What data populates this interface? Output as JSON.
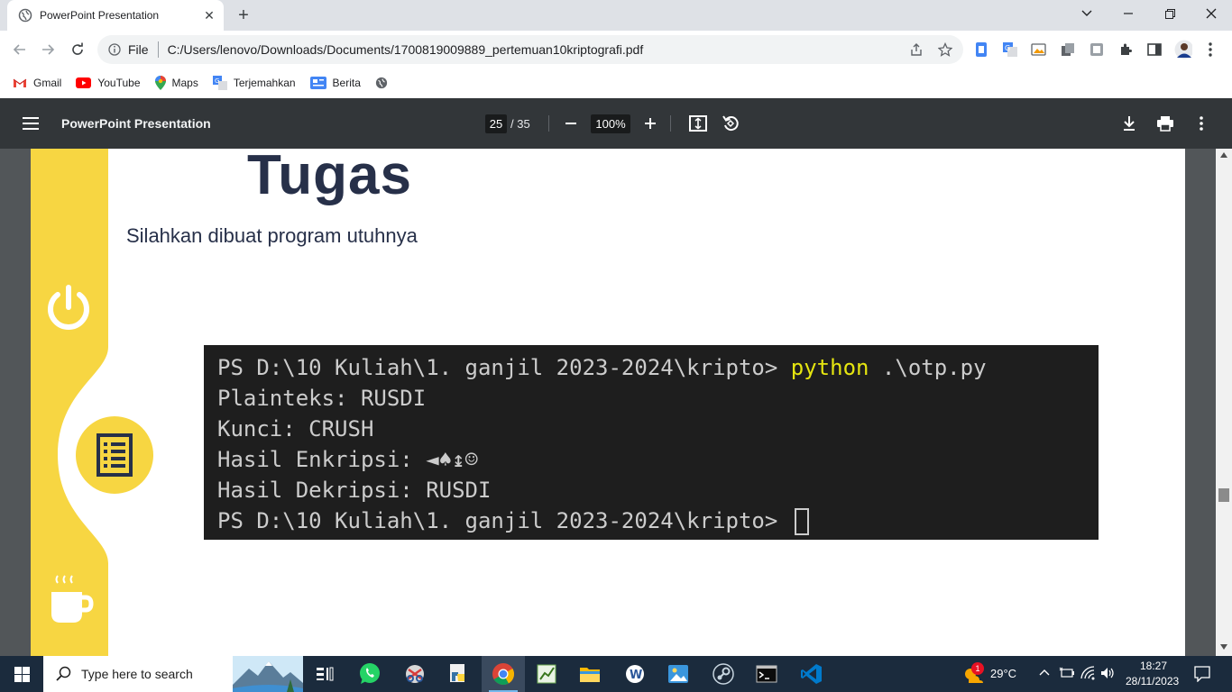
{
  "browser": {
    "tab_title": "PowerPoint Presentation",
    "url_scheme": "File",
    "url": "C:/Users/lenovo/Downloads/Documents/1700819009889_pertemuan10kriptografi.pdf"
  },
  "bookmarks": [
    {
      "label": "Gmail",
      "icon": "gmail-icon"
    },
    {
      "label": "YouTube",
      "icon": "youtube-icon"
    },
    {
      "label": "Maps",
      "icon": "maps-icon"
    },
    {
      "label": "Terjemahkan",
      "icon": "translate-icon"
    },
    {
      "label": "Berita",
      "icon": "news-icon"
    }
  ],
  "pdf": {
    "title": "PowerPoint Presentation",
    "current_page": "25",
    "total_pages": "/ 35",
    "zoom": "100%"
  },
  "slide": {
    "title": "Tugas",
    "subtitle": "Silahkan dibuat program utuhnya",
    "terminal": {
      "line1_prompt": "PS D:\\10 Kuliah\\1. ganjil 2023-2024\\kripto> ",
      "line1_cmd": "python",
      "line1_arg": " .\\otp.py",
      "line2": "Plainteks: RUSDI",
      "line3": "Kunci: CRUSH",
      "line4": "Hasil Enkripsi: ◄♠↨☺",
      "line5": "Hasil Dekripsi: RUSDI",
      "line6": "PS D:\\10 Kuliah\\1. ganjil 2023-2024\\kripto> "
    }
  },
  "taskbar": {
    "search_placeholder": "Type here to search",
    "weather": "29°C",
    "weather_badge": "1",
    "time": "18:27",
    "date": "28/11/2023"
  },
  "colors": {
    "slide_accent": "#f7d642",
    "slide_text": "#273049",
    "terminal_bg": "#1e1e1e",
    "terminal_cmd": "#e5e510"
  }
}
